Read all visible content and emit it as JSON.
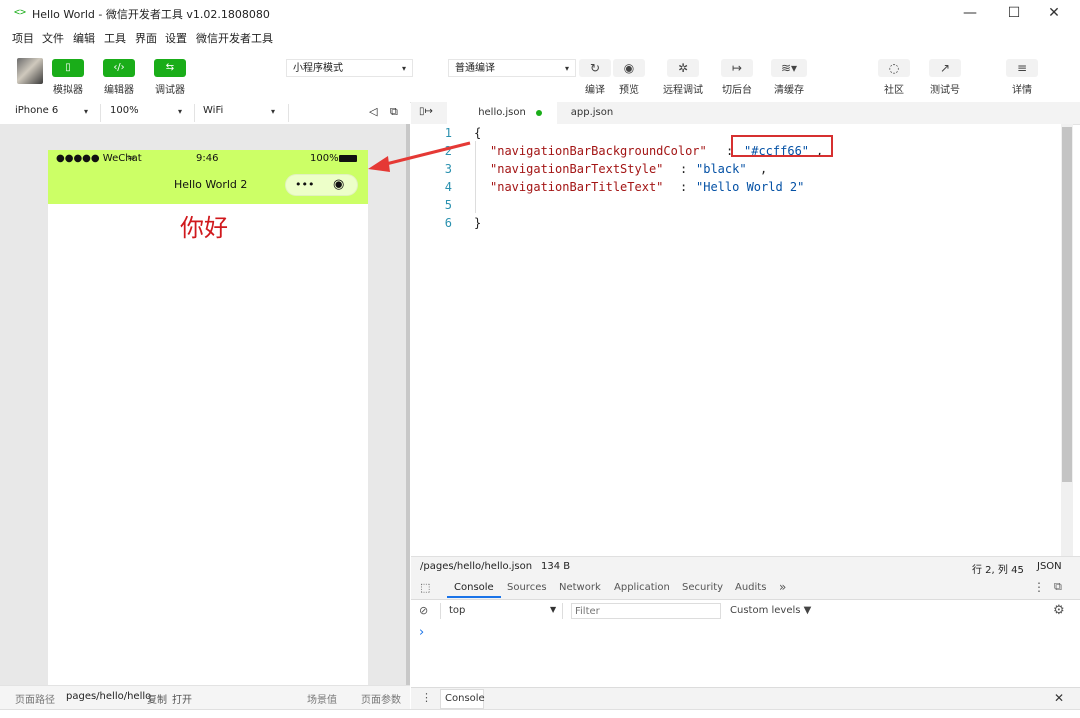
{
  "window": {
    "title": "Hello World - 微信开发者工具 v1.02.1808080",
    "logo": "<>",
    "minimize": "—",
    "maximize": "☐",
    "close": "✕"
  },
  "menu": [
    "项目",
    "文件",
    "编辑",
    "工具",
    "界面",
    "设置",
    "微信开发者工具"
  ],
  "toolbar": {
    "simulator_label": "模拟器",
    "editor_label": "编辑器",
    "debugger_label": "调试器",
    "mode_select": "小程序模式",
    "compile_select": "普通编译",
    "compile_label": "编译",
    "preview_label": "预览",
    "remote_debug_label": "远程调试",
    "background_label": "切后台",
    "clear_cache_label": "清缓存",
    "community_label": "社区",
    "test_account_label": "测试号",
    "details_label": "详情"
  },
  "device": {
    "model": "iPhone 6",
    "zoom": "100%",
    "network": "WiFi"
  },
  "phone": {
    "carrier": "●●●●● WeChat",
    "time": "9:46",
    "battery": "100%",
    "nav_title": "Hello World 2",
    "content_text": "你好",
    "nav_bg": "#ccff66"
  },
  "sim_footer": {
    "path_label": "页面路径",
    "path": "pages/hello/hello",
    "copy": "复制",
    "open": "打开",
    "scene": "场景值",
    "params": "页面参数"
  },
  "tabs": [
    {
      "label": "hello.json",
      "active": true
    },
    {
      "label": "app.json",
      "active": false
    }
  ],
  "code": {
    "line_numbers": [
      "1",
      "2",
      "3",
      "4",
      "5",
      "6"
    ],
    "open_brace": "{",
    "close_brace": "}",
    "k1": "\"navigationBarBackgroundColor\"",
    "v1": "\"#ccff66\"",
    "k2": "\"navigationBarTextStyle\"",
    "v2": "\"black\"",
    "k3": "\"navigationBarTitleText\"",
    "v3": "\"Hello World 2\""
  },
  "editor_status": {
    "file_path": "/pages/hello/hello.json",
    "file_size": "134 B",
    "cursor": "行 2, 列 45",
    "language": "JSON"
  },
  "devtools": {
    "tabs": [
      "Console",
      "Sources",
      "Network",
      "Application",
      "Security",
      "Audits"
    ],
    "more": "»",
    "context": "top",
    "filter_placeholder": "Filter",
    "levels": "Custom levels ▼",
    "prompt": "›",
    "drawer_tab": "Console"
  }
}
